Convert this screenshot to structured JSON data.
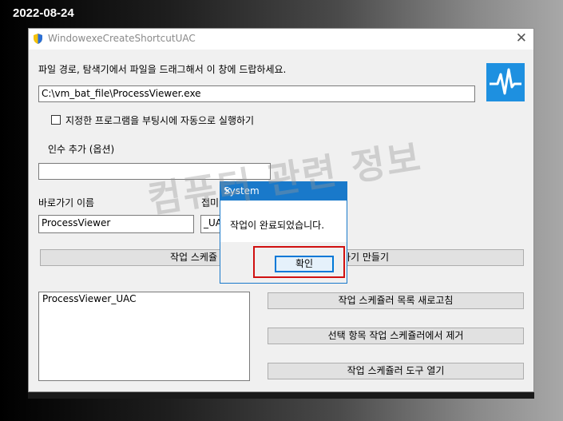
{
  "date_stamp": "2022-08-24",
  "window": {
    "title": "WindowexeCreateShortcutUAC",
    "close_glyph": "✕"
  },
  "main": {
    "instruction": "파일 경로, 탐색기에서 파일을 드래그해서 이 창에 드랍하세요.",
    "file_path": "C:\\vm_bat_file\\ProcessViewer.exe",
    "autorun_label": "지정한 프로그램을 부팅시에 자동으로 실행하기",
    "args_label": "인수 추가 (옵션)",
    "args_value": "",
    "shortcut_name_label": "바로가기 이름",
    "shortcut_name_value": "ProcessViewer",
    "suffix_label": "접미",
    "suffix_value": "_UA",
    "create_task_button_left": "작업 스케쥴",
    "create_task_button_right": "하기 만들기",
    "task_list": [
      "ProcessViewer_UAC"
    ],
    "refresh_button": "작업 스케쥴러 목록 새로고침",
    "remove_button": "선택 항목 작업 스케쥴러에서 제거",
    "open_tool_button": "작업 스케쥴러 도구 열기"
  },
  "dialog": {
    "title": "System",
    "close_glyph": "✕",
    "message": "작업이 완료되었습니다.",
    "ok_button": "확인"
  },
  "watermark": "컴퓨터 관련 정보",
  "colors": {
    "accent": "#1979ca",
    "highlight": "#d01010",
    "app_icon_bg": "#1e90e0"
  }
}
